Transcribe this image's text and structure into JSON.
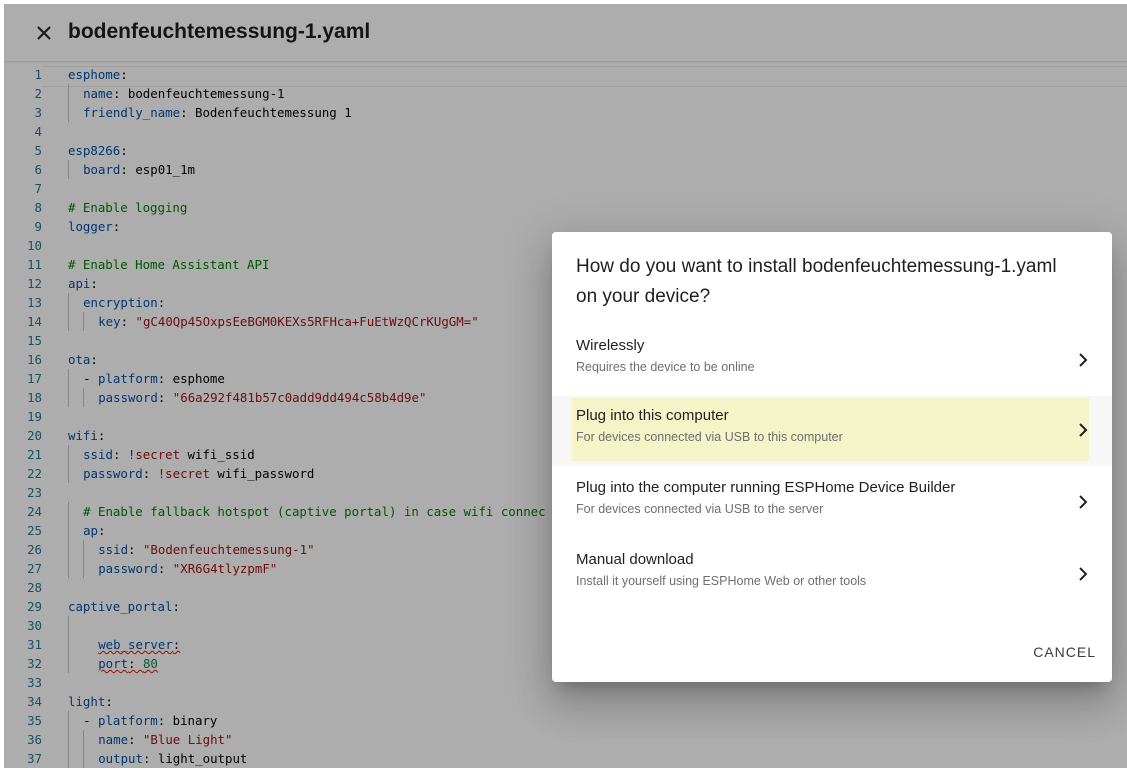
{
  "header": {
    "title": "bodenfeuchtemessung-1.yaml",
    "close_icon": "close-icon"
  },
  "editor": {
    "lines": [
      {
        "n": "1",
        "t": "esphome:"
      },
      {
        "n": "2",
        "t": "name: bodenfeuchtemessung-1"
      },
      {
        "n": "3",
        "t": "friendly_name: Bodenfeuchtemessung 1"
      },
      {
        "n": "4",
        "t": ""
      },
      {
        "n": "5",
        "t": "esp8266:"
      },
      {
        "n": "6",
        "t": "board: esp01_1m"
      },
      {
        "n": "7",
        "t": ""
      },
      {
        "n": "8",
        "t": "# Enable logging"
      },
      {
        "n": "9",
        "t": "logger:"
      },
      {
        "n": "10",
        "t": ""
      },
      {
        "n": "11",
        "t": "# Enable Home Assistant API"
      },
      {
        "n": "12",
        "t": "api:"
      },
      {
        "n": "13",
        "t": "encryption:"
      },
      {
        "n": "14",
        "t": "key: \"gC40Qp45OxpsEeBGM0KEXs5RFHca+FuEtWzQCrKUgGM=\""
      },
      {
        "n": "15",
        "t": ""
      },
      {
        "n": "16",
        "t": "ota:"
      },
      {
        "n": "17",
        "t": "- platform: esphome"
      },
      {
        "n": "18",
        "t": "password: \"66a292f481b57c0add9dd494c58b4d9e\""
      },
      {
        "n": "19",
        "t": ""
      },
      {
        "n": "20",
        "t": "wifi:"
      },
      {
        "n": "21",
        "t": "ssid: !secret wifi_ssid"
      },
      {
        "n": "22",
        "t": "password: !secret wifi_password"
      },
      {
        "n": "23",
        "t": ""
      },
      {
        "n": "24",
        "t": "# Enable fallback hotspot (captive portal) in case wifi connec"
      },
      {
        "n": "25",
        "t": "ap:"
      },
      {
        "n": "26",
        "t": "ssid: \"Bodenfeuchtemessung-1\""
      },
      {
        "n": "27",
        "t": "password: \"XR6G4tlyzpmF\""
      },
      {
        "n": "28",
        "t": ""
      },
      {
        "n": "29",
        "t": "captive_portal:"
      },
      {
        "n": "30",
        "t": ""
      },
      {
        "n": "31",
        "t": "web_server:"
      },
      {
        "n": "32",
        "t": "port: 80"
      },
      {
        "n": "33",
        "t": ""
      },
      {
        "n": "34",
        "t": "light:"
      },
      {
        "n": "35",
        "t": "- platform: binary"
      },
      {
        "n": "36",
        "t": "name: \"Blue Light\""
      },
      {
        "n": "37",
        "t": "output: light_output"
      }
    ]
  },
  "dialog": {
    "title": "How do you want to install bodenfeuchtemessung-1.yaml on your device?",
    "options": [
      {
        "label": "Wirelessly",
        "description": "Requires the device to be online"
      },
      {
        "label": "Plug into this computer",
        "description": "For devices connected via USB to this computer"
      },
      {
        "label": "Plug into the computer running ESPHome Device Builder",
        "description": "For devices connected via USB to the server"
      },
      {
        "label": "Manual download",
        "description": "Install it yourself using ESPHome Web or other tools"
      }
    ],
    "cancel_label": "CANCEL"
  },
  "colors": {
    "highlight": "#f3f4c8",
    "line_number": "#237893",
    "key": "#0451a5",
    "string": "#a31515",
    "comment": "#008000"
  }
}
